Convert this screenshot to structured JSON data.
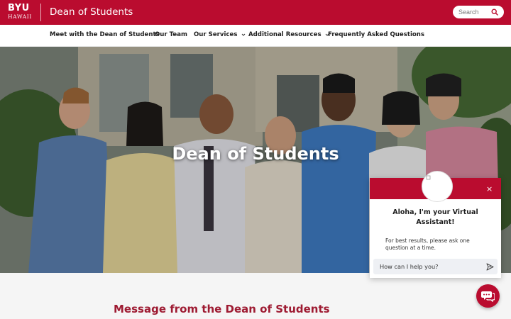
{
  "header": {
    "logo": {
      "line1": "BYU",
      "line2": "HAWAII"
    },
    "site_title": "Dean of Students",
    "search": {
      "placeholder": "Search",
      "icon": "search-icon"
    },
    "colors": {
      "brand": "#ba0c2f",
      "text_on_brand": "#ffffff"
    }
  },
  "nav": {
    "items": [
      {
        "label": "Meet with the Dean of Students",
        "has_dropdown": false
      },
      {
        "label": "Our Team",
        "has_dropdown": false
      },
      {
        "label": "Our Services",
        "has_dropdown": true
      },
      {
        "label": "Additional Resources",
        "has_dropdown": true
      },
      {
        "label": "Frequently Asked Questions",
        "has_dropdown": false
      }
    ]
  },
  "hero": {
    "title": "Dean of Students"
  },
  "main": {
    "section_title": "Message from the Dean of Students",
    "section_title_color": "#9e1b32"
  },
  "chat": {
    "close_label": "×",
    "greeting": "Aloha, I'm your Virtual Assistant!",
    "tip": "For best results, please ask one question at a time.",
    "input_placeholder": "How can I help you?",
    "send_icon": "send-icon",
    "launcher_icon": "chat-bubbles-icon"
  }
}
